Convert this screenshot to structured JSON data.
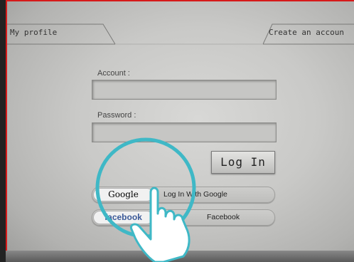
{
  "tabs": {
    "left": "My profile",
    "right": "Create an accoun"
  },
  "form": {
    "account_label": "Account :",
    "account_value": "",
    "password_label": "Password :",
    "password_value": ""
  },
  "login_button": "Log In",
  "social": {
    "google_logo": "Google",
    "google_text": "Log In With Google",
    "facebook_logo": "facebook",
    "facebook_text": "Facebook"
  },
  "colors": {
    "accent_red": "#d61a1a",
    "circle_teal": "#3fb8c6",
    "facebook_blue": "#3b5998"
  },
  "icons": {
    "gesture": "tap-hand-icon"
  }
}
